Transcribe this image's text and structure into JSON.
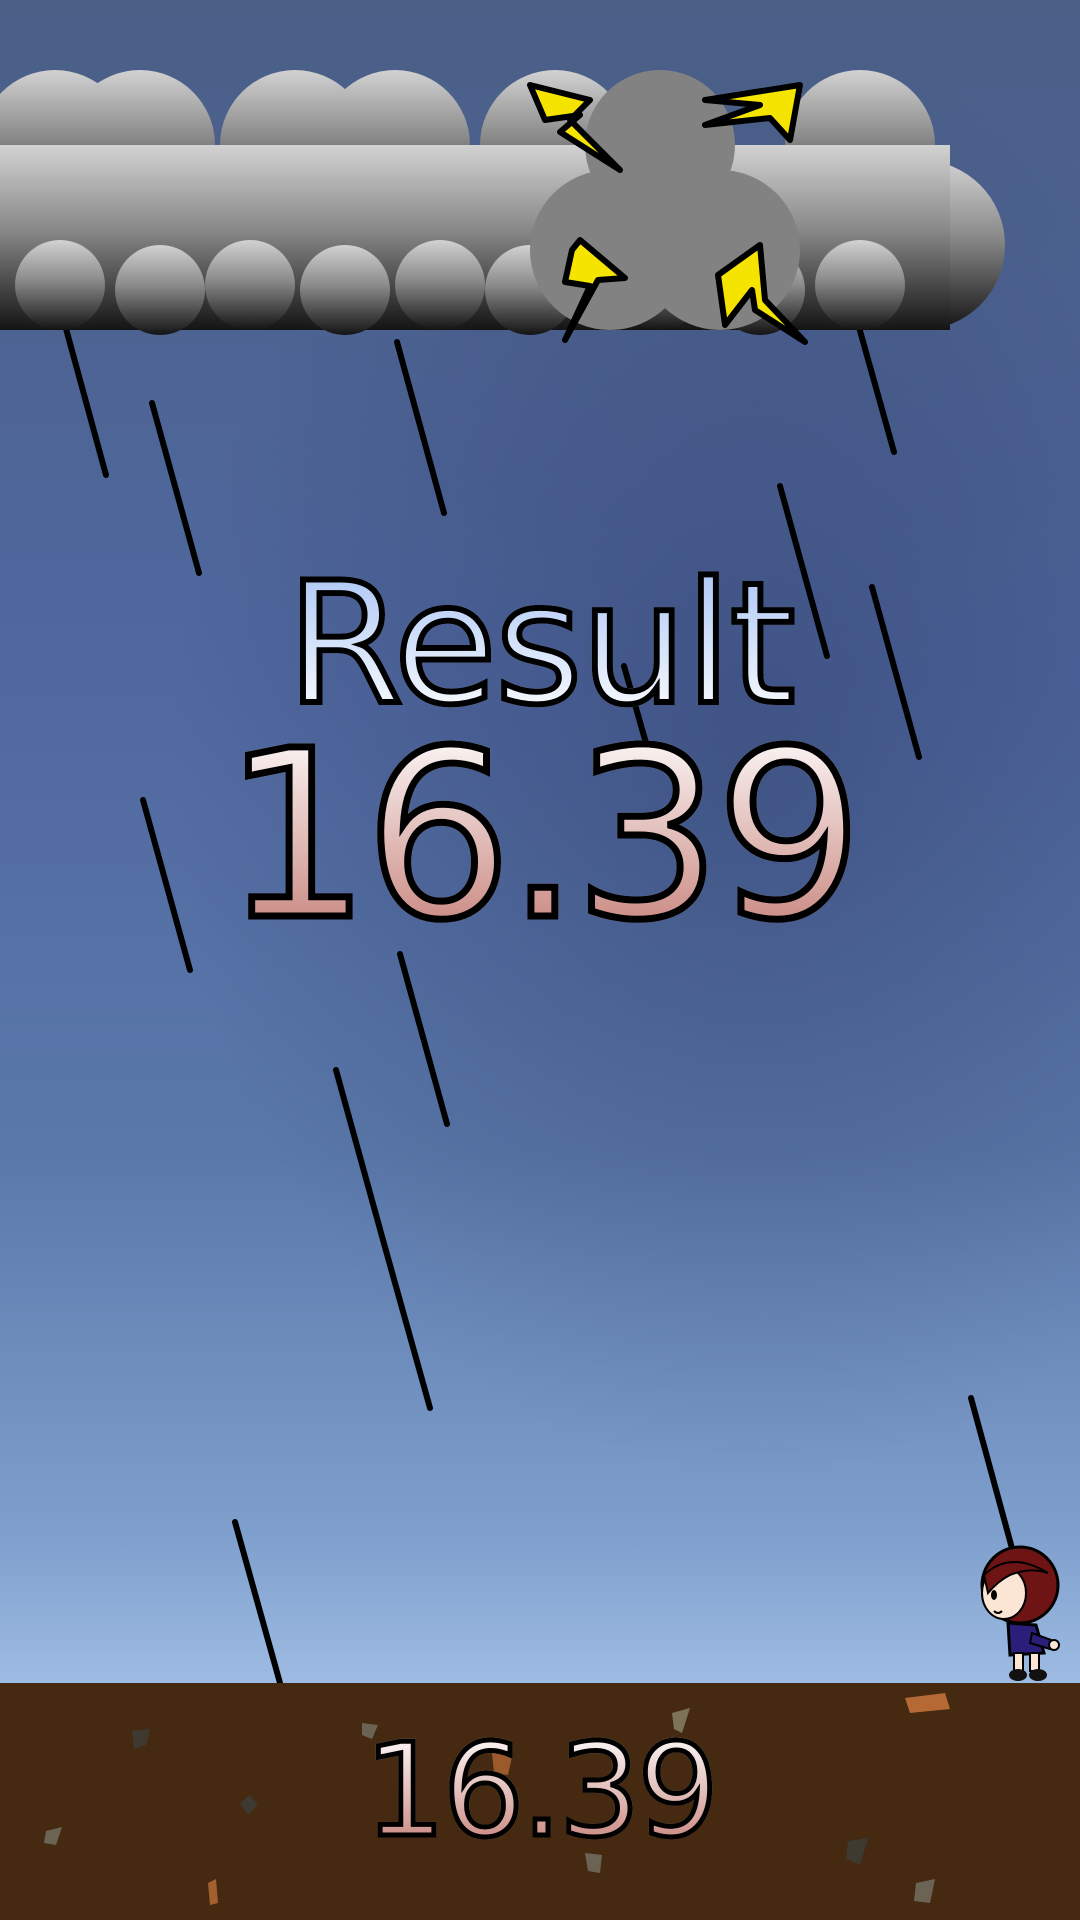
{
  "screen": {
    "title": "Result",
    "score": "16.39",
    "ground_score": "16.39"
  },
  "colors": {
    "sky_top": "#4a5f86",
    "sky_bottom": "#9fbde3",
    "ground": "#452910",
    "lightning": "#f5e400",
    "title_gradient_top": "#a9c4f5",
    "score_gradient_bottom": "#c47c74"
  },
  "icons": {
    "lightning": "lightning-bolt-icon",
    "cloud": "storm-cloud",
    "character": "player-character"
  }
}
